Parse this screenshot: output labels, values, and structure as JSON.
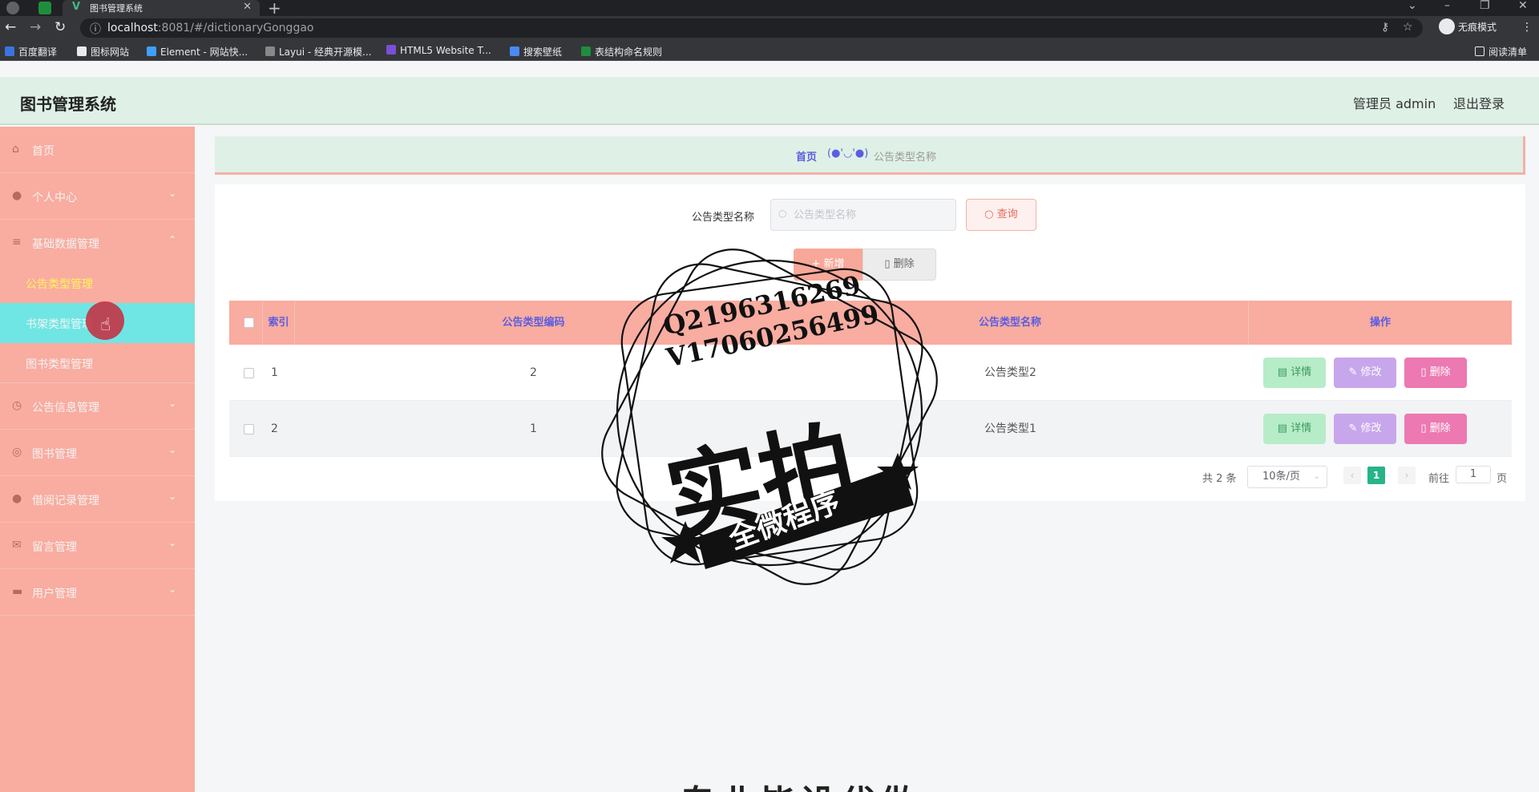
{
  "browser": {
    "tab_title": "图书管理系统",
    "url_host": "localhost",
    "url_path": ":8081/#/dictionaryGonggao",
    "incognito_label": "无痕模式",
    "reading_list": "阅读清单",
    "bookmarks": [
      "百度翻译",
      "图标网站",
      "Element - 网站快...",
      "Layui - 经典开源模...",
      "HTML5 Website T...",
      "搜索壁纸",
      "表结构命名规则"
    ]
  },
  "header": {
    "title": "图书管理系统",
    "user": "管理员 admin",
    "logout": "退出登录"
  },
  "sidebar": {
    "items": [
      {
        "label": "首页",
        "icon": "home-icon"
      },
      {
        "label": "个人中心",
        "icon": "user-icon"
      },
      {
        "label": "基础数据管理",
        "icon": "menu-icon"
      },
      {
        "label": "公告信息管理",
        "icon": "clock-icon"
      },
      {
        "label": "图书管理",
        "icon": "book-icon"
      },
      {
        "label": "借阅记录管理",
        "icon": "location-icon"
      },
      {
        "label": "留言管理",
        "icon": "mail-icon"
      },
      {
        "label": "用户管理",
        "icon": "monitor-icon"
      }
    ],
    "sub_items": [
      "公告类型管理",
      "书架类型管理",
      "图书类型管理"
    ]
  },
  "breadcrumb": {
    "home": "首页",
    "separator": "(●'◡'●)",
    "current": "公告类型名称"
  },
  "search": {
    "label": "公告类型名称",
    "placeholder": "公告类型名称",
    "query_button": "查询"
  },
  "actions": {
    "add": "新增",
    "delete": "删除"
  },
  "table": {
    "headers": {
      "index": "索引",
      "code": "公告类型编码",
      "name": "公告类型名称",
      "ops": "操作"
    },
    "rows": [
      {
        "index": "1",
        "code": "2",
        "name": "公告类型2"
      },
      {
        "index": "2",
        "code": "1",
        "name": "公告类型1"
      }
    ],
    "op_labels": {
      "detail": "详情",
      "edit": "修改",
      "delete": "删除"
    }
  },
  "pagination": {
    "total": "共 2 条",
    "page_size": "10条/页",
    "current_page": "1",
    "goto_label": "前往",
    "goto_value": "1",
    "page_suffix": "页"
  },
  "watermark": {
    "line1": "Q2196316269",
    "line2": "V17060256499",
    "big": "实拍",
    "ribbon": "全微程序",
    "bottom": "专业毕设代做"
  }
}
